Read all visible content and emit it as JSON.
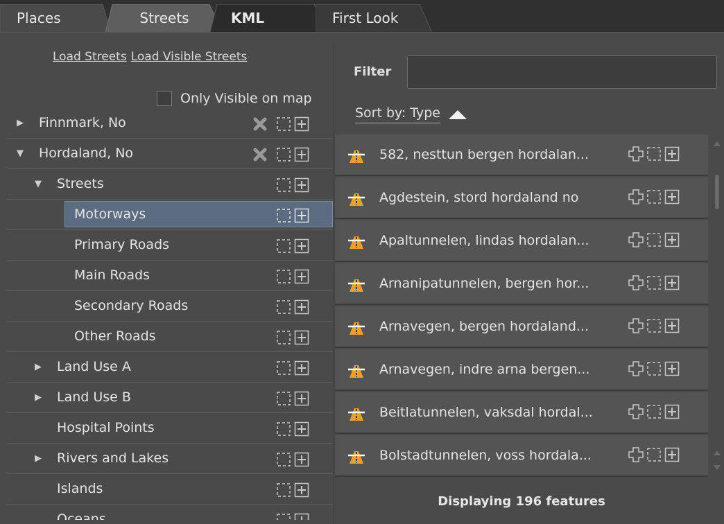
{
  "tabs": [
    {
      "label": "Places"
    },
    {
      "label": "Streets"
    },
    {
      "label": "KML"
    },
    {
      "label": "First Look"
    }
  ],
  "streets_panel": {
    "load_streets_label": "Load Streets",
    "load_visible_label": "Load Visible Streets",
    "only_visible_label": "Only Visible on map",
    "only_visible_checked": false,
    "tree": [
      {
        "label": "Finnmark, No",
        "expanded": false
      },
      {
        "label": "Hordaland, No",
        "expanded": true
      },
      {
        "label": "Streets",
        "expanded": true
      },
      {
        "label": "Motorways",
        "selected": true
      },
      {
        "label": "Primary Roads"
      },
      {
        "label": "Main Roads"
      },
      {
        "label": "Secondary Roads"
      },
      {
        "label": "Other Roads"
      },
      {
        "label": "Land Use A",
        "expanded": false
      },
      {
        "label": "Land Use B",
        "expanded": false
      },
      {
        "label": "Hospital Points"
      },
      {
        "label": "Rivers and Lakes",
        "expanded": false
      },
      {
        "label": "Islands"
      },
      {
        "label": "Oceans"
      }
    ]
  },
  "features": {
    "filter_label": "Filter",
    "filter_value": "",
    "sort_label": "Sort by: Type",
    "sort_direction": "ascending",
    "items": [
      {
        "label": "582,  nesttun bergen hordalan..."
      },
      {
        "label": "Agdestein,  stord hordaland no"
      },
      {
        "label": "Apaltunnelen,  lindas hordalan..."
      },
      {
        "label": "Arnanipatunnelen,  bergen hor..."
      },
      {
        "label": "Arnavegen,  bergen hordaland..."
      },
      {
        "label": "Arnavegen,  indre arna bergen..."
      },
      {
        "label": "Beitlatunnelen,  vaksdal hordal..."
      },
      {
        "label": "Bolstadtunnelen,  voss hordala..."
      }
    ],
    "status": "Displaying 196 features"
  },
  "icons": {
    "remove": "x-icon",
    "select": "dashed-select-icon",
    "add": "plus-box-icon",
    "road": "road-icon",
    "move": "cross-outline-icon"
  },
  "colors": {
    "background": "#4a4a4a",
    "tabbar": "#303030",
    "selection": "#5b6c81",
    "road_icon_orange": "#f0a020"
  }
}
